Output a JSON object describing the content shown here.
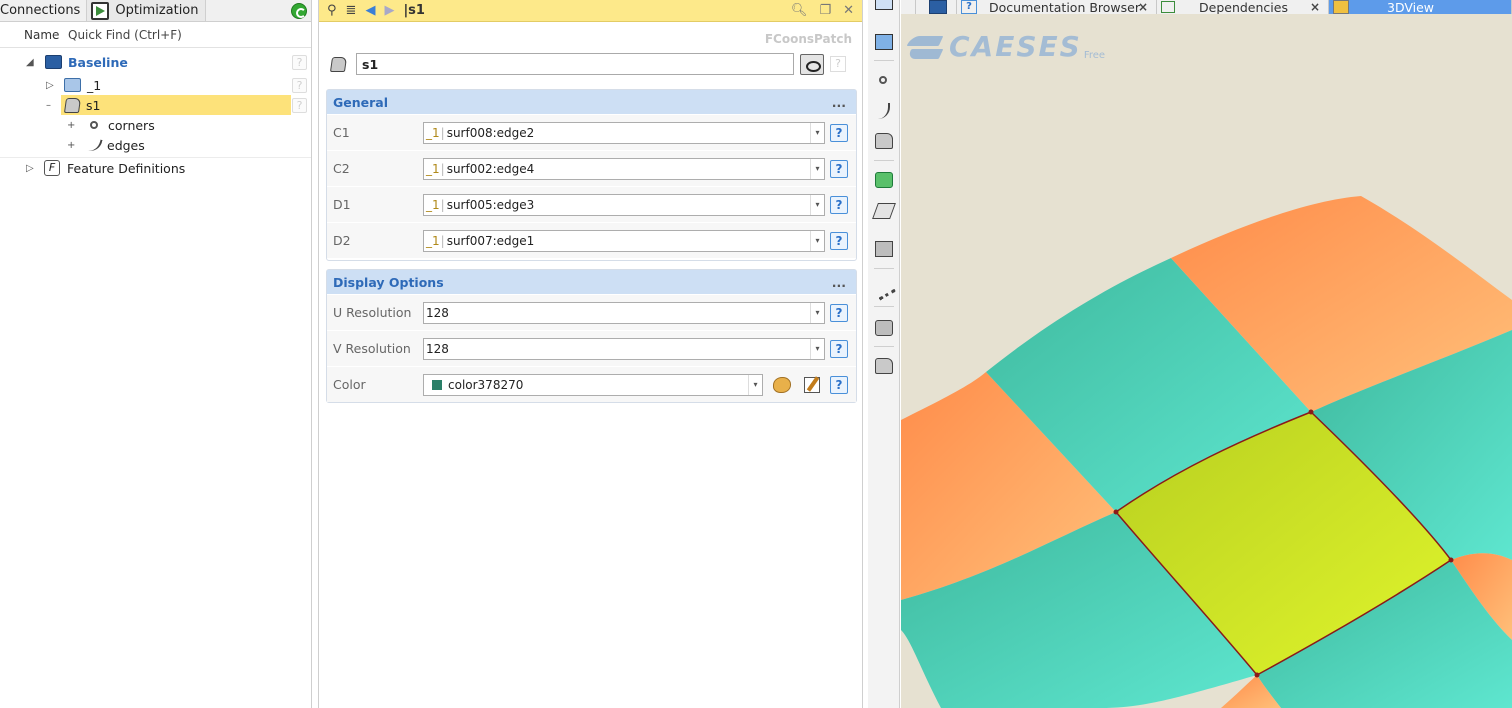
{
  "tree": {
    "tabs": [
      "Connections",
      "Optimization"
    ],
    "col_name": "Name",
    "quick_find": "Quick Find (Ctrl+F)",
    "items": [
      {
        "label": "Baseline"
      },
      {
        "label": "_1"
      },
      {
        "label": "s1"
      },
      {
        "label": "corners"
      },
      {
        "label": "edges"
      },
      {
        "label": "Feature Definitions"
      }
    ],
    "help_glyph": "?"
  },
  "props": {
    "path": "|s1",
    "type": "FCoonsPatch",
    "name": "s1",
    "help_glyph": "?",
    "general": {
      "title": "General",
      "more": "...",
      "rows": [
        {
          "label": "C1",
          "prefix": "_1",
          "sep": "|",
          "value": "surf008:edge2"
        },
        {
          "label": "C2",
          "prefix": "_1",
          "sep": "|",
          "value": "surf002:edge4"
        },
        {
          "label": "D1",
          "prefix": "_1",
          "sep": "|",
          "value": "surf005:edge3"
        },
        {
          "label": "D2",
          "prefix": "_1",
          "sep": "|",
          "value": "surf007:edge1"
        }
      ]
    },
    "display": {
      "title": "Display Options",
      "more": "...",
      "u_label": "U Resolution",
      "u_value": "128",
      "v_label": "V Resolution",
      "v_value": "128",
      "color_label": "Color",
      "color_value": "color378270",
      "color_hex": "#2a7f68"
    }
  },
  "view": {
    "tabs": [
      "Documentation Browser",
      "Dependencies",
      "3DView"
    ],
    "close_glyph": "×",
    "logo": "CAESES",
    "logo_sub": "Free",
    "colors": {
      "surface_teal": "#4ecdb4",
      "surface_orange": "#ff9a5c",
      "selected_patch": "#c8d92a",
      "patch_edge": "#8a1a1a",
      "background": "#e6e1d1"
    }
  }
}
